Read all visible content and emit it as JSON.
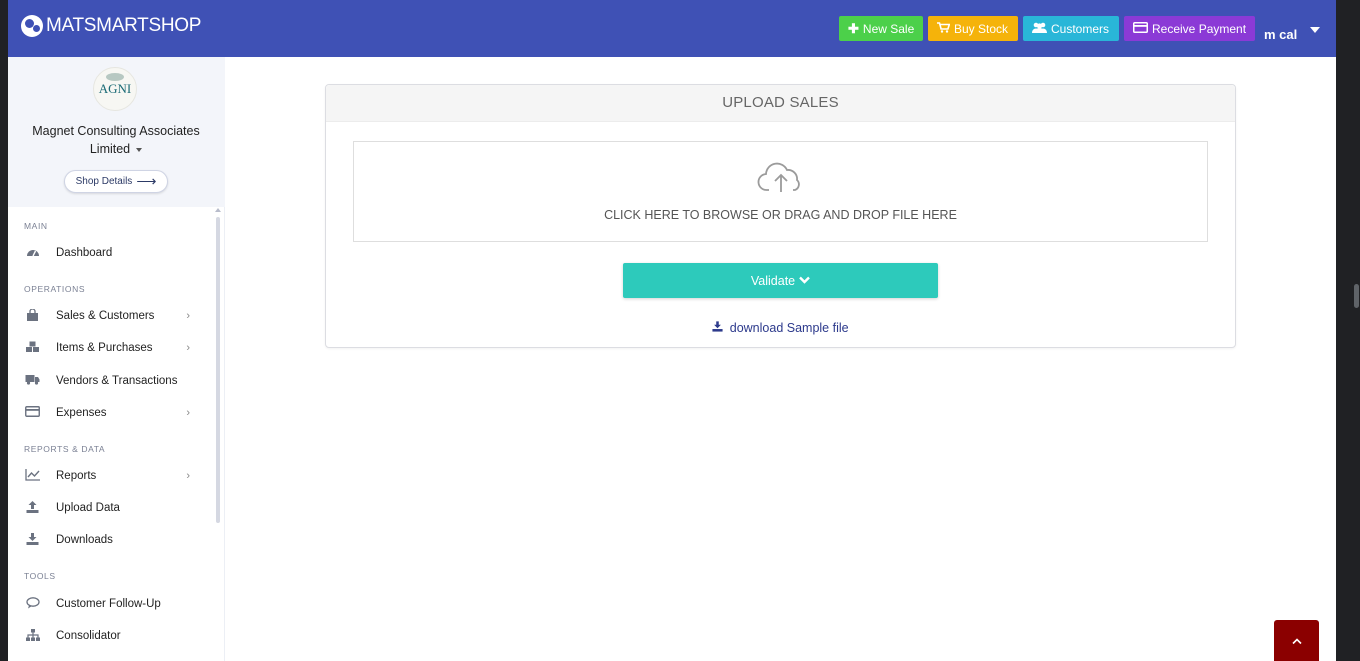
{
  "topbar": {
    "brand": "MATSMARTSHOP",
    "buttons": {
      "new_sale": "New Sale",
      "buy_stock": "Buy Stock",
      "customers": "Customers",
      "receive_payment": "Receive Payment"
    },
    "user": "m cal"
  },
  "sidebar": {
    "shop_logo_text": "AGNI",
    "shop_name": "Magnet Consulting Associates Limited",
    "shop_details": "Shop Details",
    "sections": {
      "main": "MAIN",
      "operations": "OPERATIONS",
      "reports": "REPORTS & DATA",
      "tools": "TOOLS"
    },
    "items": {
      "dashboard": "Dashboard",
      "sales_customers": "Sales & Customers",
      "items_purchases": "Items & Purchases",
      "vendors_transactions": "Vendors & Transactions",
      "expenses": "Expenses",
      "reports": "Reports",
      "upload_data": "Upload Data",
      "downloads": "Downloads",
      "customer_follow_up": "Customer Follow-Up",
      "consolidator": "Consolidator"
    }
  },
  "main": {
    "card_title": "UPLOAD SALES",
    "drop_text": "CLICK HERE TO BROWSE OR DRAG AND DROP FILE HERE",
    "validate": "Validate",
    "download_sample": "download Sample file"
  },
  "colors": {
    "topbar": "#3f51b5",
    "new_sale": "#4cd04a",
    "buy_stock": "#f5b30a",
    "customers": "#29b6d8",
    "receive_payment": "#8b3ad6",
    "validate": "#2dcabb",
    "scroll_top": "#8b0000"
  }
}
